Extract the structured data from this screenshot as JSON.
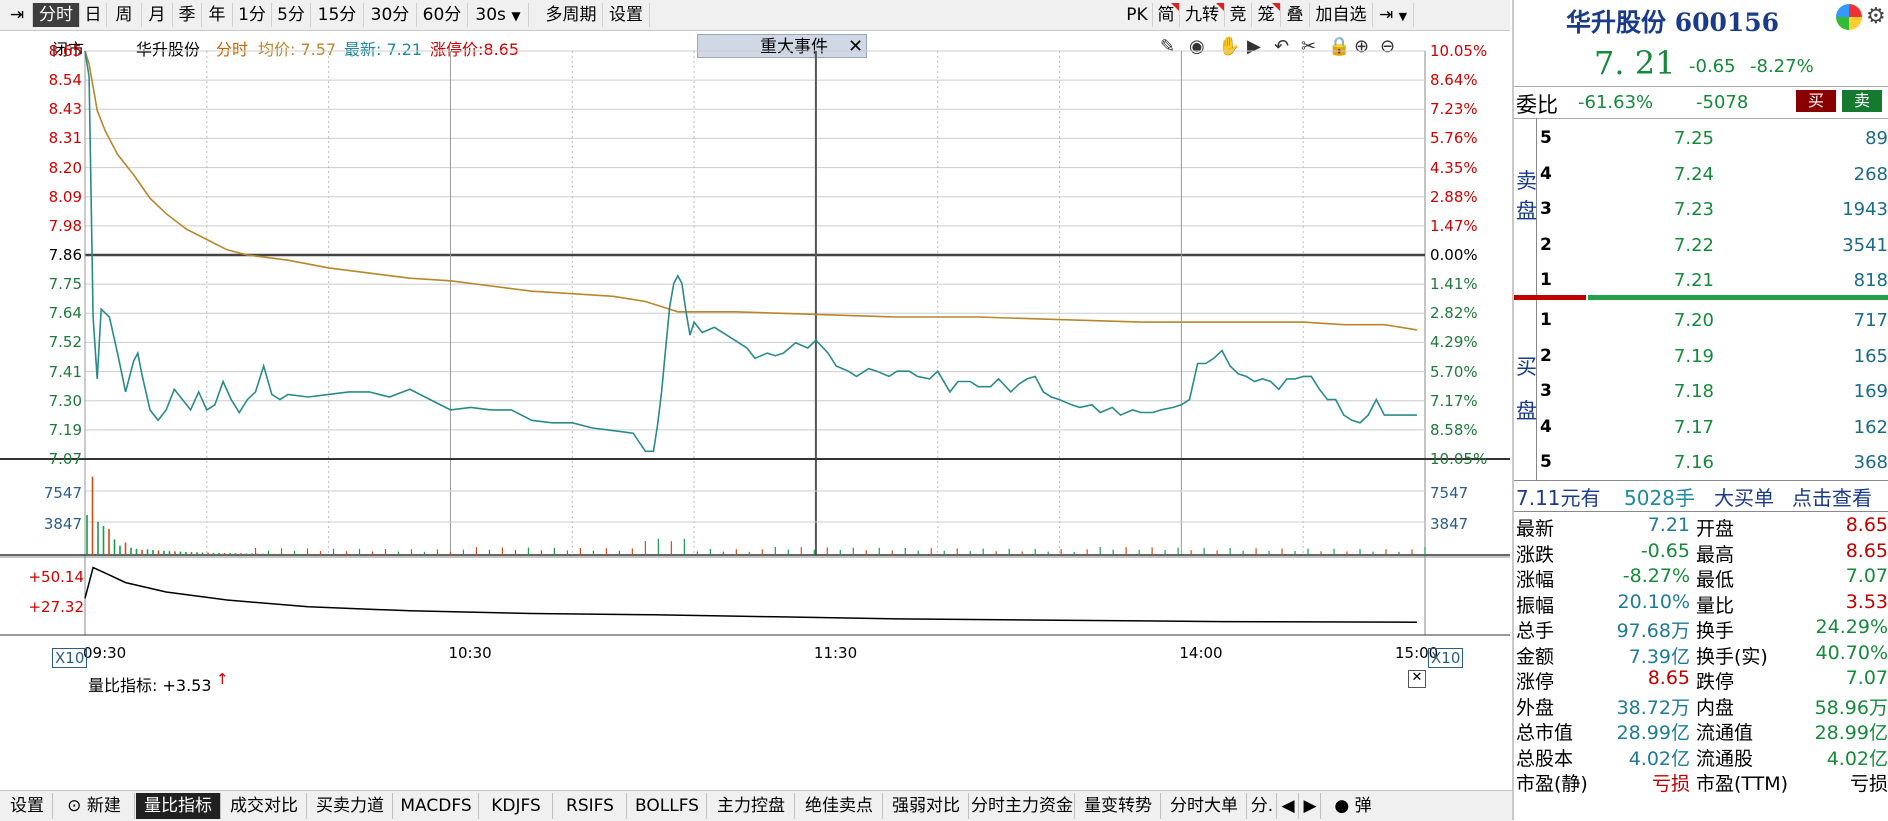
{
  "toolbar": {
    "timeframes": [
      "分时",
      "日",
      "周",
      "月",
      "季",
      "年",
      "1分",
      "5分",
      "15分",
      "30分",
      "60分",
      "30s",
      "多周期",
      "设置"
    ],
    "right_items": [
      "PK",
      "简",
      "九转",
      "竞",
      "笼",
      "叠",
      "加自选"
    ]
  },
  "infobar": {
    "status": "闭市",
    "stock_name": "华升股份",
    "mode": "分时",
    "avg_label": "均价: 7.57",
    "latest_label": "最新: 7.21",
    "limit_up_label": "涨停价:8.65",
    "event_tag": "重大事件"
  },
  "chart_data": {
    "type": "line",
    "price_axis": [
      "8.65",
      "8.54",
      "8.43",
      "8.31",
      "8.20",
      "8.09",
      "7.98",
      "7.86",
      "7.75",
      "7.64",
      "7.52",
      "7.41",
      "7.30",
      "7.19",
      "7.07"
    ],
    "pct_axis": [
      "10.05%",
      "8.64%",
      "7.23%",
      "5.76%",
      "4.35%",
      "2.88%",
      "1.47%",
      "0.00%",
      "1.41%",
      "2.82%",
      "4.29%",
      "5.70%",
      "7.17%",
      "8.58%",
      "10.05%"
    ],
    "ylim": [
      7.07,
      8.65
    ],
    "prev_close": 7.86,
    "volume_axis": [
      "7547",
      "3847"
    ],
    "volume_unit": "X10",
    "ratio_axis": [
      "+50.14",
      "+27.32"
    ],
    "ratio_label": "量比指标: +3.53",
    "time_labels": [
      "09:30",
      "10:30",
      "11:30",
      "14:00",
      "15:00"
    ],
    "price_series": [
      [
        0,
        8.65
      ],
      [
        1,
        8.55
      ],
      [
        2,
        7.62
      ],
      [
        3,
        7.38
      ],
      [
        4,
        7.65
      ],
      [
        6,
        7.62
      ],
      [
        8,
        7.48
      ],
      [
        10,
        7.33
      ],
      [
        12,
        7.45
      ],
      [
        13,
        7.48
      ],
      [
        14,
        7.4
      ],
      [
        16,
        7.26
      ],
      [
        18,
        7.22
      ],
      [
        20,
        7.26
      ],
      [
        22,
        7.34
      ],
      [
        24,
        7.3
      ],
      [
        26,
        7.26
      ],
      [
        28,
        7.33
      ],
      [
        30,
        7.26
      ],
      [
        32,
        7.28
      ],
      [
        34,
        7.37
      ],
      [
        36,
        7.3
      ],
      [
        38,
        7.25
      ],
      [
        40,
        7.3
      ],
      [
        42,
        7.33
      ],
      [
        44,
        7.43
      ],
      [
        46,
        7.32
      ],
      [
        48,
        7.3
      ],
      [
        50,
        7.32
      ],
      [
        55,
        7.31
      ],
      [
        60,
        7.32
      ],
      [
        65,
        7.33
      ],
      [
        70,
        7.33
      ],
      [
        75,
        7.31
      ],
      [
        80,
        7.34
      ],
      [
        85,
        7.3
      ],
      [
        90,
        7.26
      ],
      [
        95,
        7.27
      ],
      [
        100,
        7.26
      ],
      [
        105,
        7.26
      ],
      [
        110,
        7.22
      ],
      [
        115,
        7.21
      ],
      [
        120,
        7.21
      ],
      [
        125,
        7.19
      ],
      [
        130,
        7.18
      ],
      [
        135,
        7.17
      ],
      [
        138,
        7.1
      ],
      [
        140,
        7.1
      ],
      [
        141,
        7.2
      ],
      [
        142,
        7.33
      ],
      [
        143,
        7.5
      ],
      [
        144,
        7.66
      ],
      [
        145,
        7.75
      ],
      [
        146,
        7.78
      ],
      [
        147,
        7.75
      ],
      [
        148,
        7.64
      ],
      [
        149,
        7.55
      ],
      [
        150,
        7.6
      ],
      [
        152,
        7.56
      ],
      [
        155,
        7.58
      ],
      [
        158,
        7.55
      ],
      [
        160,
        7.53
      ],
      [
        163,
        7.5
      ],
      [
        165,
        7.46
      ],
      [
        168,
        7.48
      ],
      [
        170,
        7.47
      ],
      [
        172,
        7.48
      ],
      [
        175,
        7.52
      ],
      [
        178,
        7.5
      ],
      [
        180,
        7.53
      ],
      [
        183,
        7.48
      ],
      [
        185,
        7.43
      ],
      [
        188,
        7.41
      ],
      [
        190,
        7.39
      ],
      [
        193,
        7.42
      ],
      [
        195,
        7.41
      ],
      [
        198,
        7.39
      ],
      [
        200,
        7.41
      ],
      [
        203,
        7.41
      ],
      [
        205,
        7.39
      ],
      [
        208,
        7.38
      ],
      [
        210,
        7.41
      ],
      [
        213,
        7.33
      ],
      [
        215,
        7.37
      ],
      [
        218,
        7.37
      ],
      [
        220,
        7.35
      ],
      [
        223,
        7.35
      ],
      [
        225,
        7.38
      ],
      [
        228,
        7.33
      ],
      [
        230,
        7.36
      ],
      [
        232,
        7.38
      ],
      [
        234,
        7.39
      ],
      [
        236,
        7.33
      ],
      [
        238,
        7.31
      ],
      [
        240,
        7.3
      ],
      [
        243,
        7.28
      ],
      [
        245,
        7.27
      ],
      [
        248,
        7.28
      ],
      [
        250,
        7.25
      ],
      [
        253,
        7.27
      ],
      [
        255,
        7.24
      ],
      [
        258,
        7.26
      ],
      [
        260,
        7.25
      ],
      [
        263,
        7.25
      ],
      [
        265,
        7.26
      ],
      [
        268,
        7.27
      ],
      [
        270,
        7.28
      ],
      [
        272,
        7.3
      ],
      [
        274,
        7.44
      ],
      [
        276,
        7.44
      ],
      [
        278,
        7.46
      ],
      [
        280,
        7.49
      ],
      [
        282,
        7.43
      ],
      [
        284,
        7.4
      ],
      [
        286,
        7.39
      ],
      [
        288,
        7.37
      ],
      [
        290,
        7.38
      ],
      [
        292,
        7.37
      ],
      [
        294,
        7.34
      ],
      [
        296,
        7.38
      ],
      [
        298,
        7.38
      ],
      [
        300,
        7.39
      ],
      [
        302,
        7.39
      ],
      [
        304,
        7.34
      ],
      [
        306,
        7.3
      ],
      [
        308,
        7.3
      ],
      [
        310,
        7.24
      ],
      [
        312,
        7.22
      ],
      [
        314,
        7.21
      ],
      [
        316,
        7.24
      ],
      [
        318,
        7.3
      ],
      [
        320,
        7.24
      ],
      [
        322,
        7.24
      ],
      [
        324,
        7.24
      ],
      [
        326,
        7.24
      ],
      [
        328,
        7.24
      ]
    ],
    "avg_series": [
      [
        0,
        8.65
      ],
      [
        1,
        8.6
      ],
      [
        3,
        8.42
      ],
      [
        5,
        8.34
      ],
      [
        8,
        8.25
      ],
      [
        12,
        8.17
      ],
      [
        16,
        8.08
      ],
      [
        20,
        8.02
      ],
      [
        25,
        7.96
      ],
      [
        30,
        7.92
      ],
      [
        35,
        7.88
      ],
      [
        40,
        7.86
      ],
      [
        50,
        7.84
      ],
      [
        60,
        7.81
      ],
      [
        70,
        7.79
      ],
      [
        80,
        7.77
      ],
      [
        90,
        7.76
      ],
      [
        100,
        7.74
      ],
      [
        110,
        7.72
      ],
      [
        120,
        7.71
      ],
      [
        130,
        7.7
      ],
      [
        138,
        7.68
      ],
      [
        142,
        7.66
      ],
      [
        146,
        7.64
      ],
      [
        150,
        7.64
      ],
      [
        160,
        7.64
      ],
      [
        180,
        7.63
      ],
      [
        200,
        7.62
      ],
      [
        220,
        7.62
      ],
      [
        240,
        7.61
      ],
      [
        260,
        7.6
      ],
      [
        280,
        7.6
      ],
      [
        300,
        7.6
      ],
      [
        310,
        7.59
      ],
      [
        320,
        7.59
      ],
      [
        328,
        7.57
      ]
    ],
    "volume_series": [
      3847,
      7547,
      3200,
      2800,
      2500,
      1500,
      900,
      1200,
      700,
      600,
      500,
      550,
      480,
      430,
      400,
      370,
      350,
      330,
      300,
      280,
      260,
      240,
      230,
      210,
      200,
      190,
      180,
      170,
      160,
      150,
      150,
      140,
      130,
      120,
      120,
      110,
      100,
      100,
      95,
      90
    ],
    "ratio_series": [
      [
        0,
        27.32
      ],
      [
        2,
        50.14
      ],
      [
        5,
        46
      ],
      [
        10,
        39
      ],
      [
        20,
        32
      ],
      [
        35,
        26
      ],
      [
        55,
        21
      ],
      [
        80,
        18
      ],
      [
        110,
        16
      ],
      [
        140,
        15
      ],
      [
        170,
        13.5
      ],
      [
        200,
        12
      ],
      [
        240,
        11
      ],
      [
        280,
        10
      ],
      [
        328,
        9.5
      ]
    ]
  },
  "panel": {
    "stock_title": "华升股份 600156",
    "price": "7. 21",
    "change": "-0.65",
    "change_pct": "-8.27%",
    "webi_label": "委比",
    "webi_pct": "-61.63%",
    "webi_diff": "-5078",
    "buy_btn": "买",
    "sell_btn": "卖",
    "sell_side_label": [
      "卖",
      "盘"
    ],
    "buy_side_label": [
      "买",
      "盘"
    ],
    "sell_orders": [
      {
        "level": "5",
        "price": "7.25",
        "qty": "89"
      },
      {
        "level": "4",
        "price": "7.24",
        "qty": "268"
      },
      {
        "level": "3",
        "price": "7.23",
        "qty": "1943"
      },
      {
        "level": "2",
        "price": "7.22",
        "qty": "3541"
      },
      {
        "level": "1",
        "price": "7.21",
        "qty": "818"
      }
    ],
    "buy_orders": [
      {
        "level": "1",
        "price": "7.20",
        "qty": "717"
      },
      {
        "level": "2",
        "price": "7.19",
        "qty": "165"
      },
      {
        "level": "3",
        "price": "7.18",
        "qty": "169"
      },
      {
        "level": "4",
        "price": "7.17",
        "qty": "162"
      },
      {
        "level": "5",
        "price": "7.16",
        "qty": "368"
      }
    ],
    "bigorder": {
      "price": "7.11",
      "price_unit": "元有",
      "qty": "5028手",
      "label": "大买单",
      "link": "点击查看"
    },
    "stats": [
      {
        "l1": "最新",
        "v1": "7.21",
        "l2": "开盘",
        "v2": "8.65"
      },
      {
        "l1": "涨跌",
        "v1": "-0.65",
        "l2": "最高",
        "v2": "8.65"
      },
      {
        "l1": "涨幅",
        "v1": "-8.27%",
        "l2": "最低",
        "v2": "7.07"
      },
      {
        "l1": "振幅",
        "v1": "20.10%",
        "l2": "量比",
        "v2": "3.53"
      },
      {
        "l1": "总手",
        "v1": "97.68万",
        "l2": "换手",
        "v2": "24.29%"
      },
      {
        "l1": "金额",
        "v1": "7.39亿",
        "l2": "换手(实)",
        "v2": "40.70%"
      },
      {
        "l1": "涨停",
        "v1": "8.65",
        "l2": "跌停",
        "v2": "7.07"
      },
      {
        "l1": "外盘",
        "v1": "38.72万",
        "l2": "内盘",
        "v2": "58.96万"
      },
      {
        "l1": "总市值",
        "v1": "28.99亿",
        "l2": "流通值",
        "v2": "28.99亿"
      },
      {
        "l1": "总股本",
        "v1": "4.02亿",
        "l2": "流通股",
        "v2": "4.02亿"
      },
      {
        "l1": "市盈(静)",
        "v1": "亏损",
        "l2": "市盈(TTM)",
        "v2": "亏损"
      }
    ]
  },
  "bottom_tabs": [
    "设置",
    "新建",
    "量比指标",
    "成交对比",
    "买卖力道",
    "MACDFS",
    "KDJFS",
    "RSIFS",
    "BOLLFS",
    "主力控盘",
    "绝佳卖点",
    "强弱对比",
    "分时主力资金",
    "量变转势",
    "分时大单",
    "分."
  ],
  "popup_label": "弹",
  "colors": {
    "price_line": "#2a8a8a",
    "avg_line": "#b8862b",
    "axis_red": "#d10000",
    "axis_green": "#1f7a3a",
    "volume_green": "#1a9a4a",
    "volume_red": "#d44a1a"
  }
}
